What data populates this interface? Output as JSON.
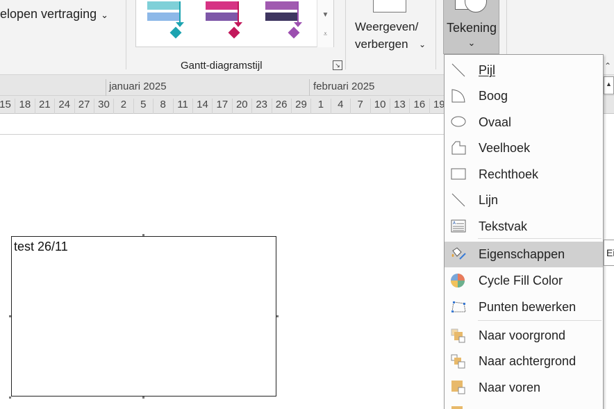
{
  "ribbon": {
    "late_tasks_label": "elopen vertraging",
    "gallery_group_label": "Gantt-diagramstijl",
    "gallery_styles": [
      {
        "bar1": "#7fd0d8",
        "bar2": "#8db8e8",
        "accent": "#1ca3b0"
      },
      {
        "bar1": "#d63384",
        "bar2": "#7e57a8",
        "accent": "#c2185b"
      },
      {
        "bar1": "#a05ab0",
        "bar2": "#3e3560",
        "accent": "#9c4fb0"
      }
    ],
    "show_hide_label": "Weergeven/ verbergen",
    "drawing_label": "Tekening"
  },
  "timescale": {
    "months": [
      "januari 2025",
      "februari 2025"
    ],
    "days": [
      "15",
      "18",
      "21",
      "24",
      "27",
      "30",
      "2",
      "5",
      "8",
      "11",
      "14",
      "17",
      "20",
      "23",
      "26",
      "29",
      "1",
      "4",
      "7",
      "10",
      "13",
      "16",
      "19"
    ]
  },
  "textbox": {
    "text": "test 26/11"
  },
  "drawing_menu": {
    "items": [
      {
        "label": "Pijl",
        "icon": "arrow-line-icon"
      },
      {
        "label": "Boog",
        "icon": "arc-icon"
      },
      {
        "label": "Ovaal",
        "icon": "oval-icon"
      },
      {
        "label": "Veelhoek",
        "icon": "polygon-icon"
      },
      {
        "label": "Rechthoek",
        "icon": "rectangle-icon"
      },
      {
        "label": "Lijn",
        "icon": "line-icon"
      },
      {
        "label": "Tekstvak",
        "icon": "textbox-icon"
      },
      {
        "label": "Eigenschappen",
        "icon": "paint-properties-icon",
        "highlighted": true
      },
      {
        "label": "Cycle Fill Color",
        "icon": "color-wheel-icon"
      },
      {
        "label": "Punten bewerken",
        "icon": "edit-points-icon"
      },
      {
        "label": "Naar voorgrond",
        "icon": "bring-to-front-icon"
      },
      {
        "label": "Naar achtergrond",
        "icon": "send-to-back-icon"
      },
      {
        "label": "Naar voren",
        "icon": "bring-forward-icon"
      }
    ],
    "tooltip_stub": "Ei"
  },
  "colors": {
    "ribbon_bg": "#f3f3f3",
    "button_active": "#c6c6c6",
    "menu_highlight": "#d0d0d0",
    "shape_fill_icon": "#e8b96a"
  }
}
